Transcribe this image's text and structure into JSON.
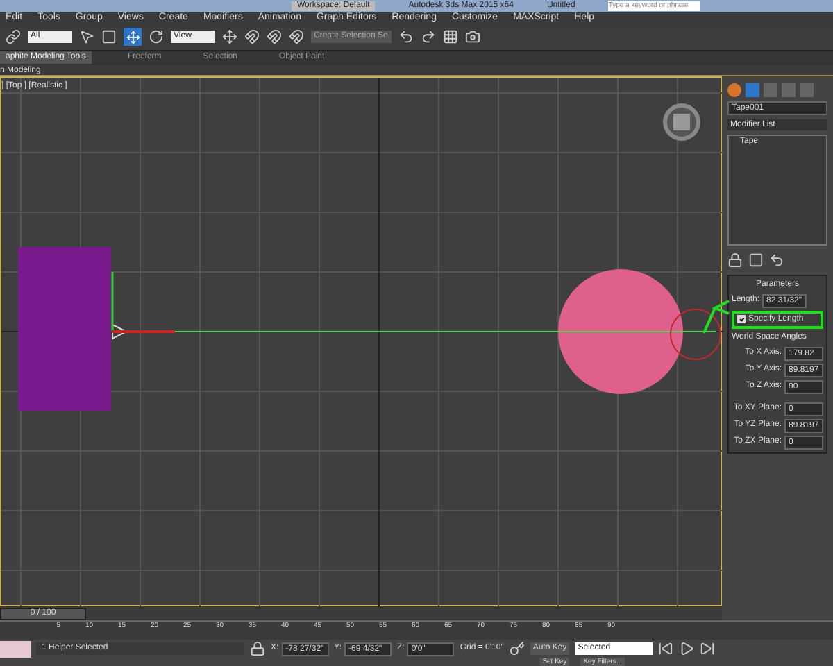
{
  "title_bar": {
    "workspace": "Workspace: Default",
    "title": "Autodesk 3ds Max 2015 x64",
    "document": "Untitled",
    "search": {
      "placeholder": "Type a keyword or phrase"
    }
  },
  "menu": [
    "Edit",
    "Tools",
    "Group",
    "Views",
    "Create",
    "Modifiers",
    "Animation",
    "Graph Editors",
    "Rendering",
    "Customize",
    "MAXScript",
    "Help"
  ],
  "toolbar": {
    "selection_filter": "All",
    "reference_coord": "View",
    "selection_set": "Create Selection Se"
  },
  "ribbon": {
    "tabs": [
      {
        "label": "aphite Modeling Tools",
        "selected": true
      },
      {
        "label": "Freeform",
        "selected": false
      },
      {
        "label": "Selection",
        "selected": false
      },
      {
        "label": "Object Paint",
        "selected": false
      }
    ],
    "panel_label": "n Modeling"
  },
  "viewport": {
    "label": "] [Top ] [Realistic ]"
  },
  "command_panel": {
    "object_name": "Tape001",
    "modifier_list": "Modifier List",
    "stack": [
      {
        "label": "Tape",
        "selected": false
      }
    ],
    "rollout": "Parameters",
    "length": {
      "label": "Length:",
      "value": "82 31/32\""
    },
    "specify_length": {
      "label": "Specify Length",
      "checked": true,
      "highlighted": true
    },
    "group": "World Space Angles",
    "angles": [
      {
        "label": "To X Axis:",
        "value": "179.82"
      },
      {
        "label": "To Y Axis:",
        "value": "89.8197"
      },
      {
        "label": "To Z Axis:",
        "value": "90"
      }
    ],
    "planes": [
      {
        "label": "To XY Plane:",
        "value": "0"
      },
      {
        "label": "To YZ Plane:",
        "value": "89.8197"
      },
      {
        "label": "To ZX Plane:",
        "value": "0"
      }
    ]
  },
  "time_slider": {
    "frame": "0 / 100",
    "level": 0
  },
  "ruler": {
    "ticks": [
      "5",
      "10",
      "15",
      "20",
      "25",
      "30",
      "35",
      "40",
      "45",
      "50",
      "55",
      "60",
      "65",
      "70",
      "75",
      "80",
      "85",
      "90"
    ]
  },
  "status": {
    "selection": "1 Helper Selected",
    "x": {
      "label": "X:",
      "value": "-78 27/32\""
    },
    "y": {
      "label": "Y:",
      "value": "-69 4/32\""
    },
    "z": {
      "label": "Z:",
      "value": "0'0\""
    },
    "grid": "Grid = 0'10\"",
    "auto_key": "Auto Key",
    "key_mode": "Selected",
    "set_key": "Set Key",
    "key_filters": "Key Filters..."
  }
}
